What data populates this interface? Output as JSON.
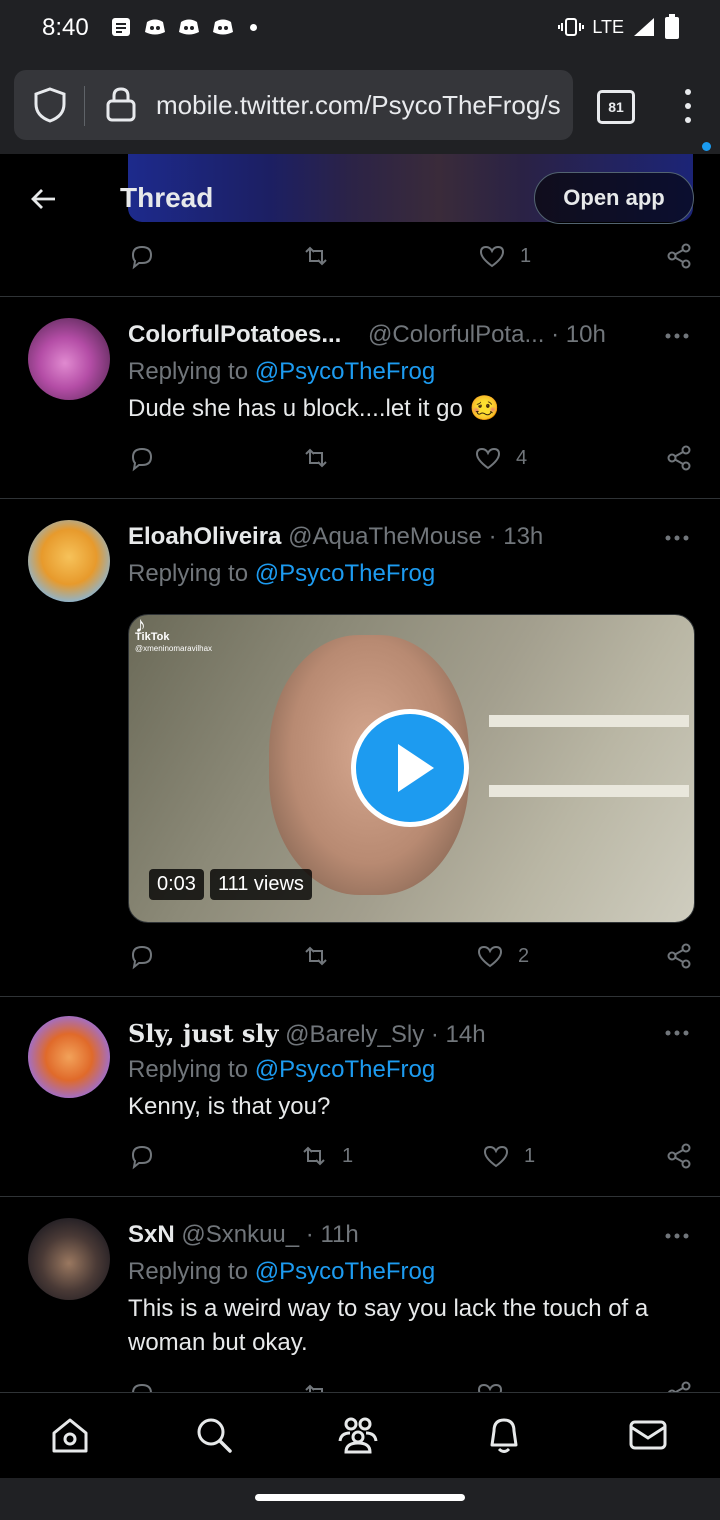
{
  "status_bar": {
    "time": "8:40",
    "network": "LTE",
    "icons": [
      "notes-icon",
      "discord-icon",
      "discord-icon",
      "discord-icon",
      "dot-icon",
      "vibrate-icon",
      "signal-icon",
      "battery-icon"
    ]
  },
  "browser": {
    "url": "mobile.twitter.com/PsycoTheFrog/s",
    "tab_count": "81",
    "accent_color": "#1a9bf0"
  },
  "header": {
    "title": "Thread",
    "open_app_label": "Open app"
  },
  "top_actions": {
    "like_count": "1"
  },
  "tweets": [
    {
      "name": "ColorfulPotatoes...",
      "handle": "@ColorfulPota...",
      "time": "· 10h",
      "replying_prefix": "Replying to ",
      "replying_to": "@PsycoTheFrog",
      "text": "Dude she has u block....let it go 🥴",
      "reply_count": "",
      "retweet_count": "",
      "like_count": "4"
    },
    {
      "name": "EloahOliveira",
      "handle": "@AquaTheMouse",
      "time": "· 13h",
      "replying_prefix": "Replying to ",
      "replying_to": "@PsycoTheFrog",
      "text": "",
      "video": {
        "watermark_app": "TikTok",
        "watermark_user": "@xmeninomaravilhax",
        "duration": "0:03",
        "views": "111 views"
      },
      "reply_count": "",
      "retweet_count": "",
      "like_count": "2"
    },
    {
      "name": "Sly, just sly",
      "handle": "@Barely_Sly",
      "time": "· 14h",
      "replying_prefix": "Replying to ",
      "replying_to": "@PsycoTheFrog",
      "text": "Kenny, is that you?",
      "reply_count": "",
      "retweet_count": "1",
      "like_count": "1"
    },
    {
      "name": "SxN",
      "handle": "@Sxnkuu_",
      "time": "· 11h",
      "replying_prefix": "Replying to ",
      "replying_to": "@PsycoTheFrog",
      "text": "This is a weird way to say you lack the touch of a woman but okay.",
      "reply_count": "",
      "retweet_count": "",
      "like_count": ""
    }
  ],
  "bottom_nav": [
    "home-icon",
    "search-icon",
    "communities-icon",
    "notifications-icon",
    "messages-icon"
  ]
}
